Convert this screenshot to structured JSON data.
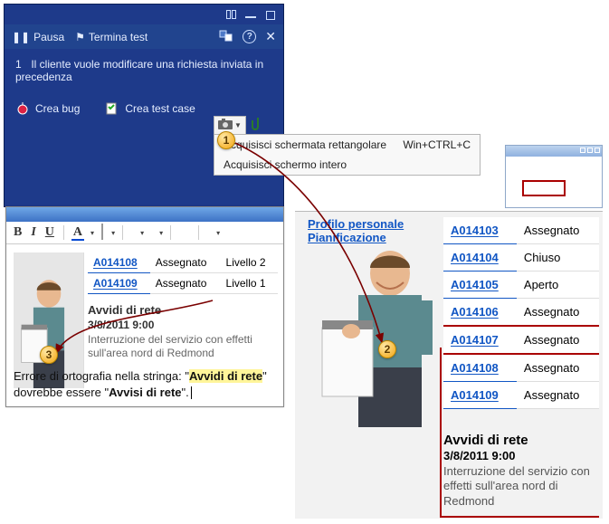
{
  "test_window": {
    "pause": "Pausa",
    "end_test": "Termina test",
    "task_num": "1",
    "task_text": "Il cliente vuole modificare una richiesta inviata in precedenza",
    "create_bug": "Crea bug",
    "create_test_case": "Crea test case"
  },
  "capture_menu": {
    "item1_label": "Acquisisci schermata rettangolare",
    "item1_shortcut": "Win+CTRL+C",
    "item2_label": "Acquisisci schermo intero"
  },
  "badges": {
    "one": "1",
    "two": "2",
    "three": "3"
  },
  "editor": {
    "rows": [
      {
        "id": "A014108",
        "status": "Assegnato",
        "level": "Livello 2"
      },
      {
        "id": "A014109",
        "status": "Assegnato",
        "level": "Livello 1"
      }
    ],
    "news_title": "Avvidi di rete",
    "news_date": "3/8/2011 9:00",
    "news_desc": "Interruzione del servizio con effetti sull'area nord di Redmond",
    "note_prefix": "Errore di ortografia nella stringa: \"",
    "note_highlight": "Avvidi di rete",
    "note_mid": "\" dovrebbe essere \"",
    "note_correct": "Avvisi di rete",
    "note_suffix": "\"."
  },
  "rightpage": {
    "link1": "Profilo personale",
    "link2": "Pianificazione",
    "rows": [
      {
        "id": "A014103",
        "status": "Assegnato"
      },
      {
        "id": "A014104",
        "status": "Chiuso"
      },
      {
        "id": "A014105",
        "status": "Aperto"
      },
      {
        "id": "A014106",
        "status": "Assegnato"
      },
      {
        "id": "A014107",
        "status": "Assegnato"
      },
      {
        "id": "A014108",
        "status": "Assegnato"
      },
      {
        "id": "A014109",
        "status": "Assegnato"
      }
    ],
    "news_title": "Avvidi di rete",
    "news_date": "3/8/2011 9:00",
    "news_desc": "Interruzione del servizio con effetti sull'area nord di Redmond"
  }
}
